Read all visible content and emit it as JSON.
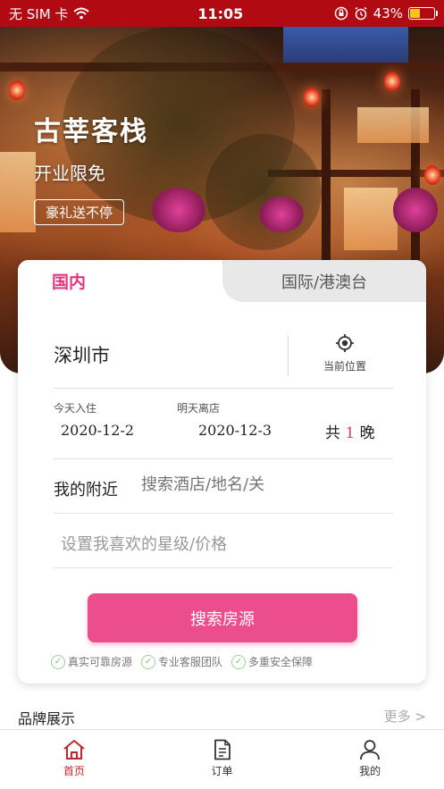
{
  "status_bar": {
    "carrier": "无 SIM 卡",
    "time": "11:05",
    "battery_percent": "43%",
    "battery_level": 0.43
  },
  "banner": {
    "title": "古莘客栈",
    "subtitle": "开业限免",
    "tag": "豪礼送不停"
  },
  "search": {
    "tabs": [
      {
        "label": "国内",
        "active": true
      },
      {
        "label": "国际/港澳台",
        "active": false
      }
    ],
    "city": "深圳市",
    "locate_label": "当前位置",
    "checkin_label": "今天入住",
    "checkin_date": "2020-12-2",
    "checkout_label": "明天离店",
    "checkout_date": "2020-12-3",
    "nights_prefix": "共",
    "nights_count": "1",
    "nights_suffix": "晚",
    "nearby_label": "我的附近",
    "nearby_placeholder": "搜索酒店/地名/关",
    "star_price_label": "设置我喜欢的星级/价格",
    "search_button": "搜索房源",
    "guarantees": [
      "真实可靠房源",
      "专业客服团队",
      "多重安全保障"
    ]
  },
  "brand": {
    "title": "品牌展示",
    "more": "更多 >"
  },
  "tabbar": {
    "items": [
      {
        "label": "首页",
        "icon": "home-icon",
        "active": true
      },
      {
        "label": "订单",
        "icon": "document-icon",
        "active": false
      },
      {
        "label": "我的",
        "icon": "user-icon",
        "active": false
      }
    ]
  },
  "colors": {
    "status_bar": "#b10a12",
    "accent_pink": "#eb4d8d",
    "tab_active_text": "#e3367f",
    "tabbar_active": "#c2272d"
  }
}
